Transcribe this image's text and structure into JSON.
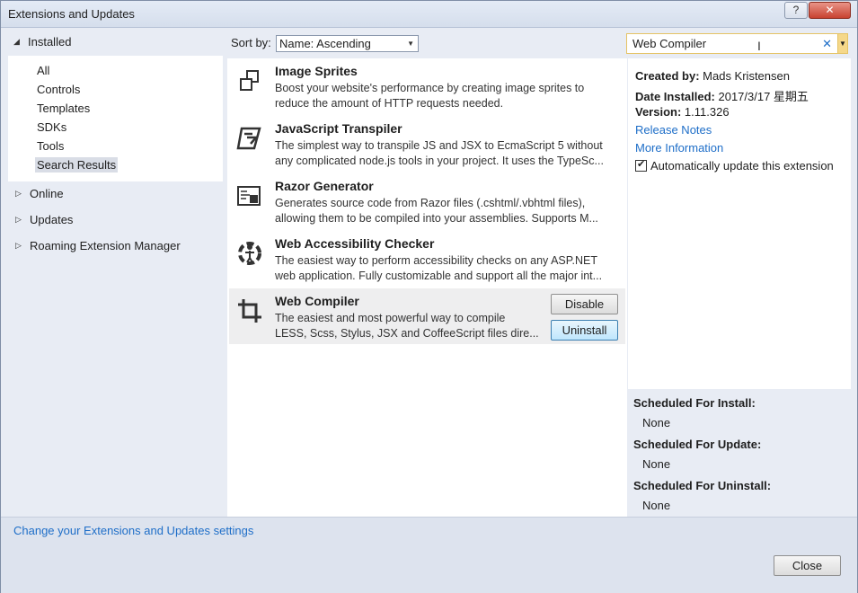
{
  "window": {
    "title": "Extensions and Updates",
    "help": "?",
    "close": "✕"
  },
  "nav": {
    "installed": "Installed",
    "sub": [
      "All",
      "Controls",
      "Templates",
      "SDKs",
      "Tools",
      "Search Results"
    ],
    "selected_index": 5,
    "online": "Online",
    "updates": "Updates",
    "roaming": "Roaming Extension Manager"
  },
  "toolbar": {
    "sort_label": "Sort by:",
    "sort_value": "Name: Ascending"
  },
  "search": {
    "value": "Web Compiler"
  },
  "extensions": [
    {
      "name": "Image Sprites",
      "line1": "Boost your website's performance by creating image sprites to",
      "line2": "reduce the amount of HTTP requests needed."
    },
    {
      "name": "JavaScript Transpiler",
      "line1": "The simplest way to transpile JS and JSX to EcmaScript 5 without",
      "line2": "any complicated node.js tools in your project. It uses the TypeSc..."
    },
    {
      "name": "Razor Generator",
      "line1": "Generates source code from Razor files (.cshtml/.vbhtml files),",
      "line2": "allowing them to be compiled into your assemblies. Supports M..."
    },
    {
      "name": "Web Accessibility Checker",
      "line1": "The easiest way to perform accessibility checks on any ASP.NET",
      "line2": "web application. Fully customizable and support all the major int..."
    },
    {
      "name": "Web Compiler",
      "line1": "The easiest and most powerful way to compile",
      "line2": "LESS, Scss, Stylus, JSX and CoffeeScript files dire..."
    }
  ],
  "buttons": {
    "disable": "Disable",
    "uninstall": "Uninstall"
  },
  "details": {
    "created_by_label": "Created by:",
    "created_by": "Mads Kristensen",
    "date_label": "Date Installed:",
    "date": "2017/3/17 星期五",
    "version_label": "Version:",
    "version": "1.11.326",
    "release_notes": "Release Notes",
    "more_info": "More Information",
    "auto_update": "Automatically update this extension"
  },
  "schedule": {
    "install_label": "Scheduled For Install:",
    "install_value": "None",
    "update_label": "Scheduled For Update:",
    "update_value": "None",
    "uninstall_label": "Scheduled For Uninstall:",
    "uninstall_value": "None"
  },
  "footer": {
    "settings_link": "Change your Extensions and Updates settings",
    "close": "Close"
  }
}
